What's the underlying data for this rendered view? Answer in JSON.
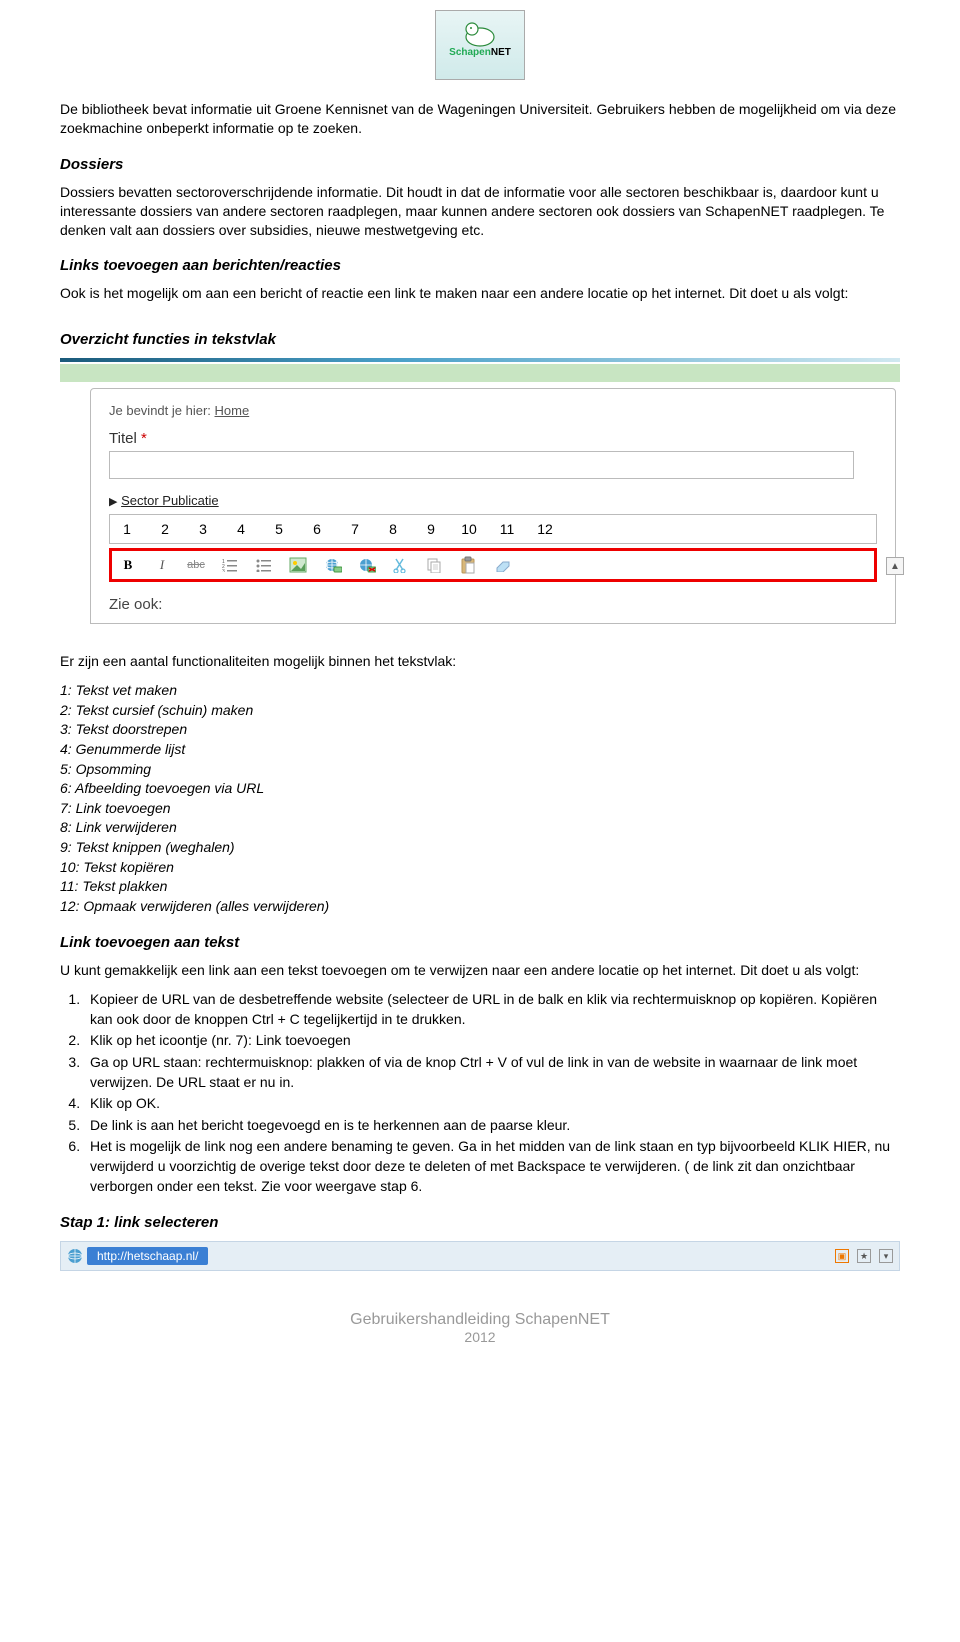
{
  "logo": {
    "brand_green": "Schapen",
    "brand_black": "NET",
    "tagline": ""
  },
  "intro_p": "De bibliotheek bevat informatie uit Groene Kennisnet van de Wageningen Universiteit. Gebruikers hebben de mogelijkheid om via deze zoekmachine onbeperkt informatie op te zoeken.",
  "h_dossiers": "Dossiers",
  "p_dossiers": "Dossiers bevatten sectoroverschrijdende informatie. Dit houdt in dat de informatie voor alle sectoren beschikbaar is, daardoor kunt u interessante dossiers van andere sectoren raadplegen, maar kunnen andere sectoren ook dossiers van SchapenNET raadplegen. Te denken valt aan dossiers over subsidies, nieuwe mestwetgeving etc.",
  "h_links": "Links toevoegen aan berichten/reacties",
  "p_links": "Ook is het mogelijk om aan een bericht of reactie een link te maken naar een andere locatie op het internet. Dit doet u als volgt:",
  "h_overzicht": "Overzicht functies in tekstvlak",
  "editor": {
    "breadcrumb_prefix": "Je bevindt je hier: ",
    "breadcrumb_link": "Home",
    "title_label": "Titel",
    "required": "*",
    "sector": "Sector Publicatie",
    "numbers": [
      "1",
      "2",
      "3",
      "4",
      "5",
      "6",
      "7",
      "8",
      "9",
      "10",
      "11",
      "12"
    ],
    "b": "B",
    "i": "I",
    "abc": "abc",
    "zie": "Zie ook:"
  },
  "p_functions_intro": "Er zijn een aantal functionaliteiten  mogelijk binnen het tekstvlak:",
  "functions": [
    "1: Tekst vet maken",
    "2: Tekst cursief (schuin) maken",
    "3: Tekst doorstrepen",
    "4: Genummerde lijst",
    "5: Opsomming",
    "6: Afbeelding toevoegen via URL",
    "7: Link toevoegen",
    "8: Link verwijderen",
    "9: Tekst knippen (weghalen)",
    "10: Tekst kopiëren",
    "11: Tekst plakken",
    "12: Opmaak verwijderen (alles verwijderen)"
  ],
  "h_linktekst": "Link toevoegen aan tekst",
  "p_linktekst": "U kunt gemakkelijk een link  aan een tekst toevoegen om te verwijzen naar een andere locatie op het internet. Dit doet u als volgt:",
  "steps": [
    "Kopieer de URL van de desbetreffende website (selecteer de URL  in de balk en klik via rechtermuisknop  op kopiëren. Kopiëren kan ook door de knoppen Ctrl + C tegelijkertijd in te drukken.",
    "Klik op het icoontje (nr. 7): Link toevoegen",
    "Ga op URL staan: rechtermuisknop: plakken of via de knop Ctrl + V of vul de link in van de website in waarnaar de link moet verwijzen.  De URL staat er nu in.",
    "Klik op OK.",
    "De link is aan het bericht toegevoegd en is te herkennen aan de paarse kleur.",
    "Het is mogelijk de link nog een andere benaming te geven. Ga in het midden van de link staan en typ bijvoorbeeld KLIK HIER, nu verwijderd u voorzichtig de overige tekst door deze te deleten of met Backspace te verwijderen. ( de link zit dan onzichtbaar verborgen onder een tekst. Zie voor weergave stap 6."
  ],
  "h_stap1": "Stap 1: link selecteren",
  "url": "http://hetschaap.nl/",
  "footer": {
    "title": "Gebruikershandleiding SchapenNET",
    "year": "2012"
  }
}
